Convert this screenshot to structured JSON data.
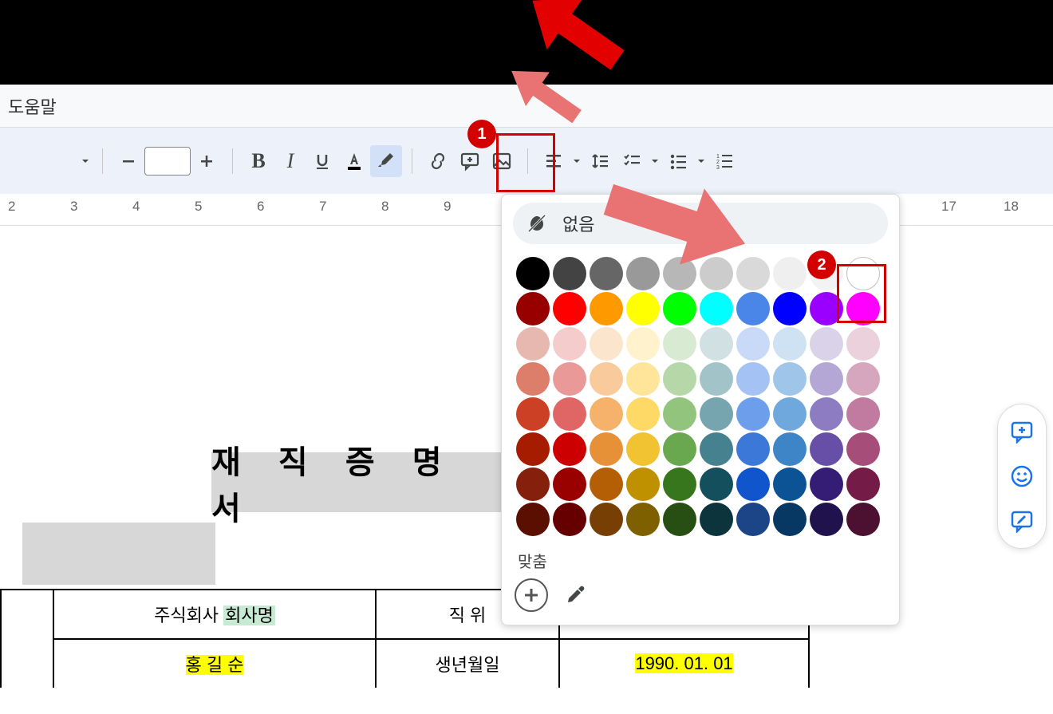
{
  "menu": {
    "help": "도움말"
  },
  "toolbar": {
    "font_size_label": "",
    "highlight_active": true
  },
  "ruler": {
    "ticks": [
      2,
      3,
      4,
      5,
      6,
      7,
      8,
      9,
      17,
      18
    ]
  },
  "colorpicker": {
    "none_label": "없음",
    "custom_label": "맞춤",
    "colors": [
      [
        "#000000",
        "#434343",
        "#666666",
        "#999999",
        "#b7b7b7",
        "#cccccc",
        "#d9d9d9",
        "#efefef",
        "#f3f3f3",
        "#ffffff"
      ],
      [
        "#980000",
        "#ff0000",
        "#ff9900",
        "#ffff00",
        "#00ff00",
        "#00ffff",
        "#4a86e8",
        "#0000ff",
        "#9900ff",
        "#ff00ff"
      ],
      [
        "#e6b8af",
        "#f4cccc",
        "#fce5cd",
        "#fff2cc",
        "#d9ead3",
        "#d0e0e3",
        "#c9daf8",
        "#cfe2f3",
        "#d9d2e9",
        "#ead1dc"
      ],
      [
        "#dd7e6b",
        "#ea9999",
        "#f9cb9c",
        "#ffe599",
        "#b6d7a8",
        "#a2c4c9",
        "#a4c2f4",
        "#9fc5e8",
        "#b4a7d6",
        "#d5a6bd"
      ],
      [
        "#cc4125",
        "#e06666",
        "#f6b26b",
        "#ffd966",
        "#93c47d",
        "#76a5af",
        "#6d9eeb",
        "#6fa8dc",
        "#8e7cc3",
        "#c27ba0"
      ],
      [
        "#a61c00",
        "#cc0000",
        "#e69138",
        "#f1c232",
        "#6aa84f",
        "#45818e",
        "#3c78d8",
        "#3d85c6",
        "#674ea7",
        "#a64d79"
      ],
      [
        "#85200c",
        "#990000",
        "#b45f06",
        "#bf9000",
        "#38761d",
        "#134f5c",
        "#1155cc",
        "#0b5394",
        "#351c75",
        "#741b47"
      ],
      [
        "#5b0f00",
        "#660000",
        "#783f04",
        "#7f6000",
        "#274e13",
        "#0c343d",
        "#1c4587",
        "#073763",
        "#20124d",
        "#4c1130"
      ]
    ]
  },
  "document": {
    "title": "재 직 증 명 서",
    "table": {
      "row1": {
        "col2_prefix": "주식회사",
        "col2_company": "회사명",
        "col3_label": "직 위"
      },
      "row2": {
        "col2_name": "홍 길 순",
        "col3_label": "생년월일",
        "col4_value": "1990. 01. 01"
      }
    }
  },
  "callouts": {
    "c1": "1",
    "c2": "2"
  }
}
